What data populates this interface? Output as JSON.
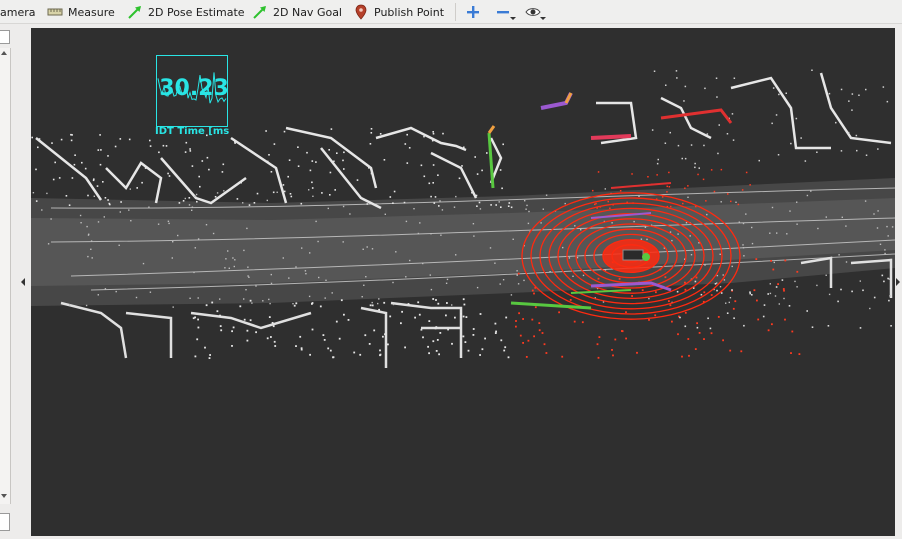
{
  "toolbar": {
    "items": [
      {
        "label": "amera",
        "icon": "camera-icon"
      },
      {
        "label": "Measure",
        "icon": "ruler-icon"
      },
      {
        "label": "2D Pose Estimate",
        "icon": "green-arrow-icon"
      },
      {
        "label": "2D Nav Goal",
        "icon": "green-arrow-icon"
      },
      {
        "label": "Publish Point",
        "icon": "map-pin-icon"
      }
    ],
    "zoom_in_icon": "plus-icon",
    "zoom_out_icon": "minus-icon",
    "view_icon": "eye-icon"
  },
  "viewport": {
    "background_color": "#2f2f2f",
    "overlay": {
      "value": "30.23",
      "label": "IDT Time [ms",
      "color": "#29e5e5"
    }
  },
  "colors": {
    "pointcloud": "#d9d9d9",
    "scan_rings": "#ff2a10",
    "markers": [
      "#e03030",
      "#9b59d0",
      "#58c840",
      "#f0a040"
    ]
  }
}
